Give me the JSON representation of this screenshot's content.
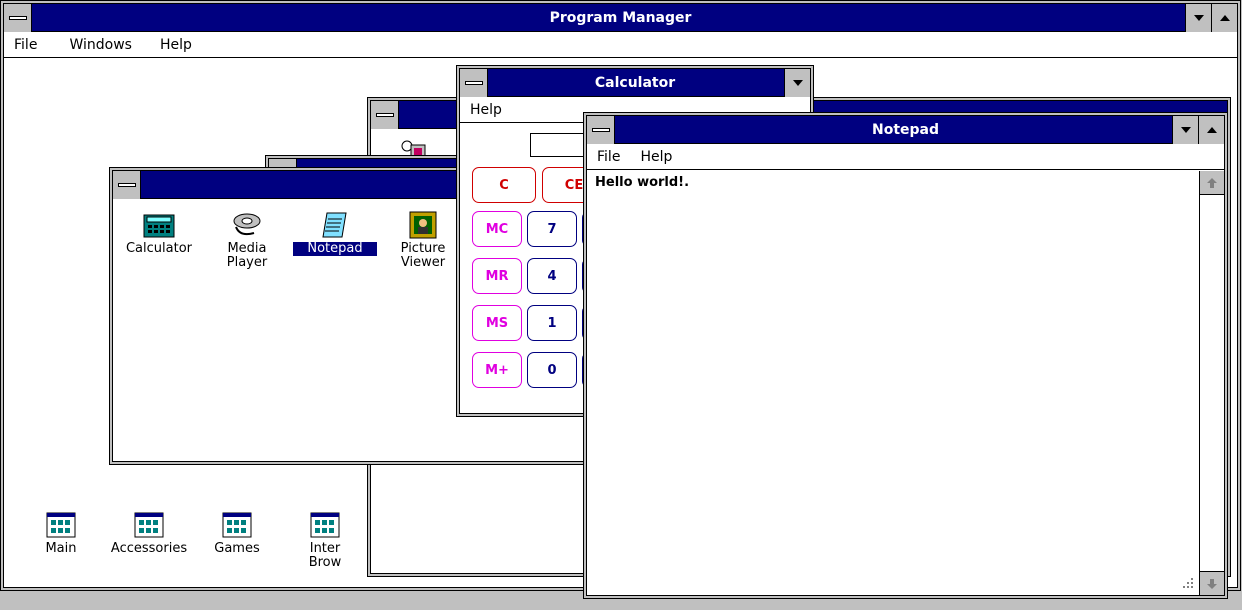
{
  "program_manager": {
    "title": "Program Manager",
    "menu": [
      "File",
      "Windows",
      "Help"
    ]
  },
  "group_windows": {
    "front_group": {
      "title": "",
      "icons": [
        {
          "label": "Calculator",
          "icon": "calculator-icon"
        },
        {
          "label": "Media\nPlayer",
          "icon": "media-player-icon"
        },
        {
          "label": "Notepad",
          "icon": "notepad-icon",
          "selected": true
        },
        {
          "label": "Picture\nViewer",
          "icon": "picture-viewer-icon"
        }
      ]
    }
  },
  "group_icons": [
    {
      "label": "Main"
    },
    {
      "label": "Accessories"
    },
    {
      "label": "Games"
    },
    {
      "label": "Inter\nBrow"
    }
  ],
  "calculator": {
    "title": "Calculator",
    "menu": [
      "Help"
    ],
    "display": "",
    "buttons": {
      "c": "C",
      "ce": "CE",
      "mc": "MC",
      "mr": "MR",
      "ms": "MS",
      "mplus": "M+",
      "d7": "7",
      "d4": "4",
      "d1": "1",
      "d0": "0"
    }
  },
  "notepad": {
    "title": "Notepad",
    "menu": [
      "File",
      "Help"
    ],
    "content": "Hello world!."
  }
}
